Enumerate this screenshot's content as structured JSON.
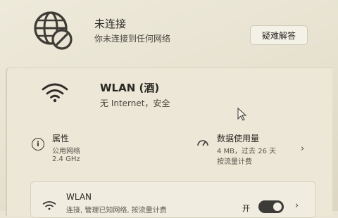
{
  "status": {
    "title": "未连接",
    "description": "你未连接到任何网络",
    "troubleshoot_label": "疑难解答"
  },
  "network": {
    "name": "WLAN (酒)",
    "status": "无 Internet，安全"
  },
  "properties": {
    "title": "属性",
    "line1": "公用网络",
    "line2": "2.4 GHz"
  },
  "data_usage": {
    "title": "数据使用量",
    "line1": "4 MB，过去 26 天",
    "line2": "按流量计费"
  },
  "wlan": {
    "title": "WLAN",
    "description": "连接, 管理已知网络, 按流量计费",
    "toggle_label": "开",
    "toggle_on": true
  },
  "icons": {
    "status": "globe-disconnected-icon",
    "network": "wifi-icon",
    "properties": "info-icon",
    "data_usage": "gauge-icon",
    "wlan": "wifi-icon",
    "chevron": "chevron-right-icon"
  }
}
